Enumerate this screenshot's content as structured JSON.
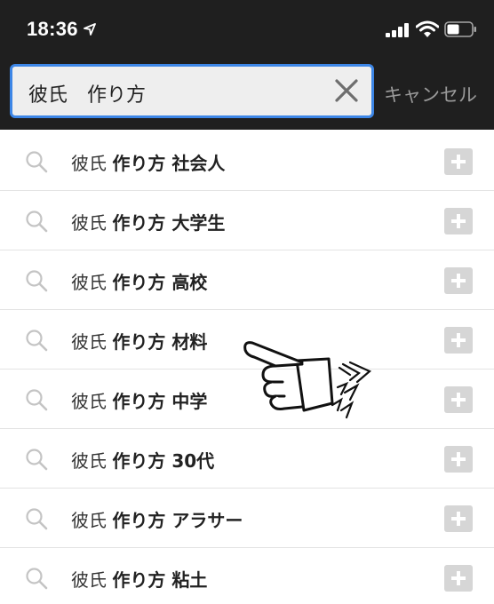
{
  "status_bar": {
    "time": "18:36",
    "icons": [
      "location-arrow-icon",
      "signal-bars-icon",
      "wifi-icon",
      "battery-icon"
    ]
  },
  "search": {
    "query": "彼氏　作り方",
    "cancel_label": "キャンセル",
    "accent_color": "#3d86e6"
  },
  "suggestions": [
    {
      "prefix": "彼氏",
      "bold": "作り方 社会人"
    },
    {
      "prefix": "彼氏",
      "bold": "作り方 大学生"
    },
    {
      "prefix": "彼氏",
      "bold": "作り方 高校"
    },
    {
      "prefix": "彼氏",
      "bold": "作り方 材料"
    },
    {
      "prefix": "彼氏",
      "bold": "作り方 中学"
    },
    {
      "prefix": "彼氏",
      "bold": "作り方 30代"
    },
    {
      "prefix": "彼氏",
      "bold": "作り方 アラサー"
    },
    {
      "prefix": "彼氏",
      "bold": "作り方 粘土"
    }
  ],
  "colors": {
    "header_bg": "#1f1f1f",
    "plus_bg": "#d6d6d6",
    "divider": "#e3e3e3"
  }
}
